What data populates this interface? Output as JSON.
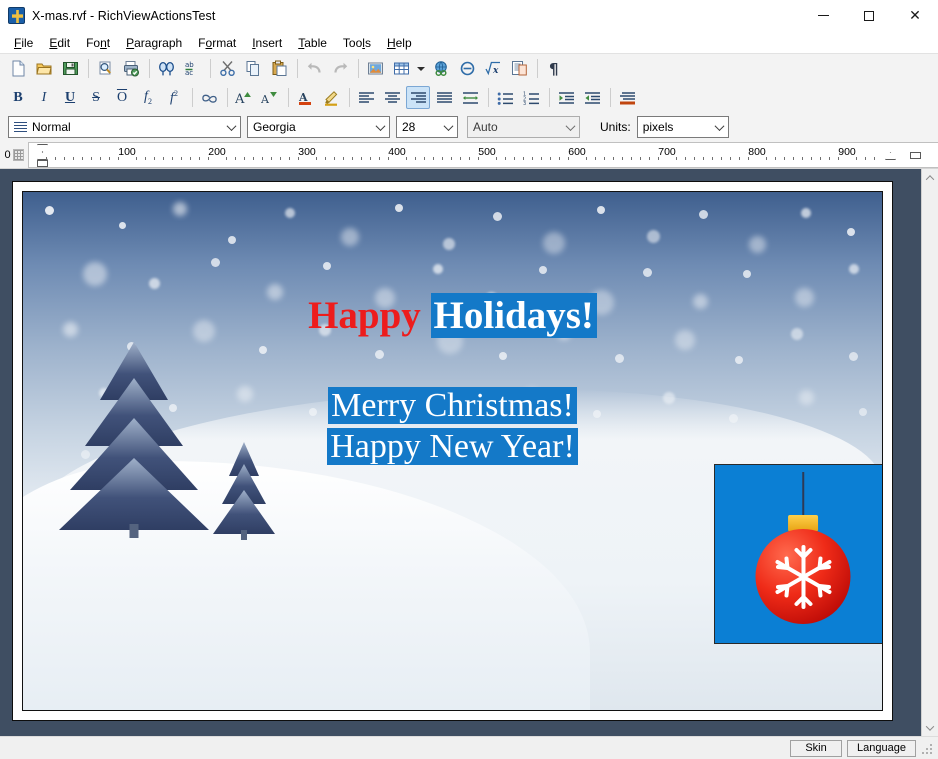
{
  "window": {
    "title": "X-mas.rvf - RichViewActionsTest",
    "icon": "app-icon",
    "controls": {
      "minimize": "minimize",
      "maximize": "maximize",
      "close": "close"
    }
  },
  "menu": {
    "items": [
      {
        "label": "File",
        "accel": "F"
      },
      {
        "label": "Edit",
        "accel": "E"
      },
      {
        "label": "Font",
        "accel": "n"
      },
      {
        "label": "Paragraph",
        "accel": "P"
      },
      {
        "label": "Format",
        "accel": "o"
      },
      {
        "label": "Insert",
        "accel": "I"
      },
      {
        "label": "Table",
        "accel": "T"
      },
      {
        "label": "Tools",
        "accel": "l"
      },
      {
        "label": "Help",
        "accel": "H"
      }
    ]
  },
  "toolbar_main": {
    "items": [
      {
        "name": "new-icon",
        "kind": "icon"
      },
      {
        "name": "open-icon",
        "kind": "icon"
      },
      {
        "name": "save-icon",
        "kind": "icon"
      },
      {
        "name": "separator",
        "kind": "sep"
      },
      {
        "name": "print-preview-icon",
        "kind": "icon"
      },
      {
        "name": "print-icon",
        "kind": "icon"
      },
      {
        "name": "separator",
        "kind": "sep"
      },
      {
        "name": "find-icon",
        "kind": "icon"
      },
      {
        "name": "replace-icon",
        "kind": "icon"
      },
      {
        "name": "separator",
        "kind": "sep"
      },
      {
        "name": "cut-icon",
        "kind": "icon"
      },
      {
        "name": "copy-icon",
        "kind": "icon"
      },
      {
        "name": "paste-icon",
        "kind": "icon"
      },
      {
        "name": "separator",
        "kind": "sep"
      },
      {
        "name": "undo-icon",
        "kind": "icon",
        "disabled": true
      },
      {
        "name": "redo-icon",
        "kind": "icon",
        "disabled": true
      },
      {
        "name": "separator",
        "kind": "sep"
      },
      {
        "name": "insert-picture-icon",
        "kind": "icon"
      },
      {
        "name": "insert-table-icon",
        "kind": "icon"
      },
      {
        "name": "table-dropdown-arrow",
        "kind": "arrow"
      },
      {
        "name": "insert-hyperlink-icon",
        "kind": "icon"
      },
      {
        "name": "insert-symbol-icon",
        "kind": "icon"
      },
      {
        "name": "insert-formula-icon",
        "kind": "icon"
      },
      {
        "name": "insert-page-icon",
        "kind": "icon"
      },
      {
        "name": "separator",
        "kind": "sep"
      },
      {
        "name": "show-formatting-marks-icon",
        "kind": "icon"
      }
    ]
  },
  "toolbar_format": {
    "items": [
      {
        "name": "bold-icon",
        "glyph": "B"
      },
      {
        "name": "italic-icon",
        "glyph": "I"
      },
      {
        "name": "underline-icon",
        "glyph": "U"
      },
      {
        "name": "strikeout-icon",
        "glyph": "S"
      },
      {
        "name": "overline-icon",
        "glyph": "O"
      },
      {
        "name": "subscript-icon",
        "glyph": "f2"
      },
      {
        "name": "superscript-icon",
        "glyph": "f2"
      },
      {
        "name": "separator",
        "glyph": "sep"
      },
      {
        "name": "insert-hyperlink-icon",
        "glyph": "link"
      },
      {
        "name": "separator",
        "glyph": "sep"
      },
      {
        "name": "grow-font-icon",
        "glyph": "A+"
      },
      {
        "name": "shrink-font-icon",
        "glyph": "A-"
      },
      {
        "name": "separator",
        "glyph": "sep"
      },
      {
        "name": "font-color-icon",
        "glyph": "Acolor"
      },
      {
        "name": "highlight-color-icon",
        "glyph": "pen"
      },
      {
        "name": "separator",
        "glyph": "sep"
      },
      {
        "name": "align-left-icon",
        "glyph": "alignleft"
      },
      {
        "name": "align-center-icon",
        "glyph": "aligncenter"
      },
      {
        "name": "align-right-icon",
        "glyph": "alignright",
        "active": true
      },
      {
        "name": "align-justify-icon",
        "glyph": "alignjustify"
      },
      {
        "name": "paragraph-spacing-icon",
        "glyph": "linespacing"
      },
      {
        "name": "separator",
        "glyph": "sep"
      },
      {
        "name": "bullet-list-icon",
        "glyph": "bullets"
      },
      {
        "name": "numbered-list-icon",
        "glyph": "numbering"
      },
      {
        "name": "separator",
        "glyph": "sep"
      },
      {
        "name": "decrease-indent-icon",
        "glyph": "outdent"
      },
      {
        "name": "increase-indent-icon",
        "glyph": "indent"
      },
      {
        "name": "separator",
        "glyph": "sep"
      },
      {
        "name": "paragraph-background-icon",
        "glyph": "parabg"
      }
    ]
  },
  "combos": {
    "style": {
      "value": "Normal",
      "label": "style-combo"
    },
    "font_name": {
      "value": "Georgia",
      "label": "font-name-combo"
    },
    "font_size": {
      "value": "28",
      "label": "font-size-combo"
    },
    "line_spacing": {
      "value": "Auto",
      "label": "line-spacing-combo",
      "disabled": true
    },
    "units_label": "Units:",
    "units": {
      "value": "pixels",
      "label": "units-combo"
    }
  },
  "ruler": {
    "corner_label": "0",
    "ticks": [
      "100",
      "200",
      "300",
      "400",
      "500",
      "600",
      "700",
      "800",
      "900"
    ]
  },
  "document": {
    "heading": {
      "part1": "Happy",
      "part2": "Holidays!"
    },
    "body": {
      "line1": "Merry Christmas!",
      "line2": "Happy New Year!"
    },
    "picture": {
      "name": "christmas-ball-ornament"
    }
  },
  "statusbar": {
    "skin_button": "Skin",
    "language_button": "Language"
  },
  "colors": {
    "heading_red": "#ed1c1c",
    "selection_blue": "#1479c8",
    "picture_background": "#0b7fd4",
    "ornament_red": "#ef2b18",
    "ornament_cap": "#f0c040",
    "workspace": "#3f4e62"
  }
}
